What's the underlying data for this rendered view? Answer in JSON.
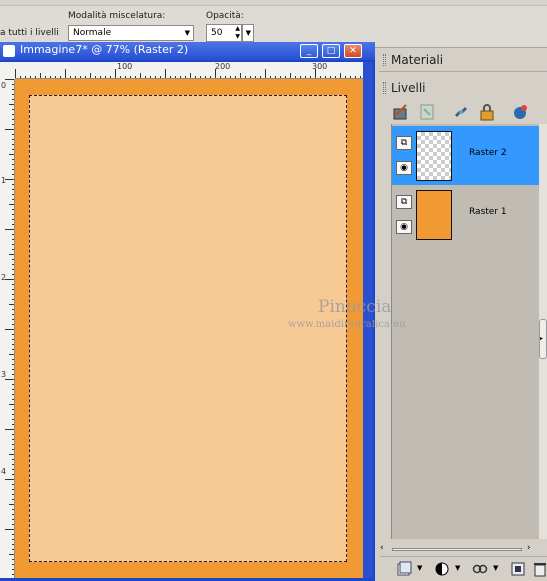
{
  "options_bar": {
    "all_layers_label": "a tutti i livelli",
    "blend_mode_label": "Modalità miscelatura:",
    "blend_mode_value": "Normale",
    "opacity_label": "Opacità:",
    "opacity_value": "50"
  },
  "document": {
    "title": "Immagine7* @ 77% (Raster 2)",
    "ruler_h_labels": [
      "100",
      "200",
      "300"
    ],
    "ruler_v_labels": [
      "0",
      "1",
      "2",
      "3",
      "4"
    ],
    "border_color": "#f19a34",
    "fill_color": "#f7c994"
  },
  "panels": {
    "materials_label": "Materiali",
    "layers_label": "Livelli"
  },
  "layers": [
    {
      "name": "Raster 2",
      "selected": true,
      "thumb": "transparent"
    },
    {
      "name": "Raster 1",
      "selected": false,
      "thumb": "#f19a34"
    }
  ],
  "watermark": {
    "name": "Pinuccia",
    "url": "www.maidiregrafica.eu"
  },
  "colors": {
    "selection_blue": "#3399ff",
    "window_blue": "#2650d3"
  }
}
